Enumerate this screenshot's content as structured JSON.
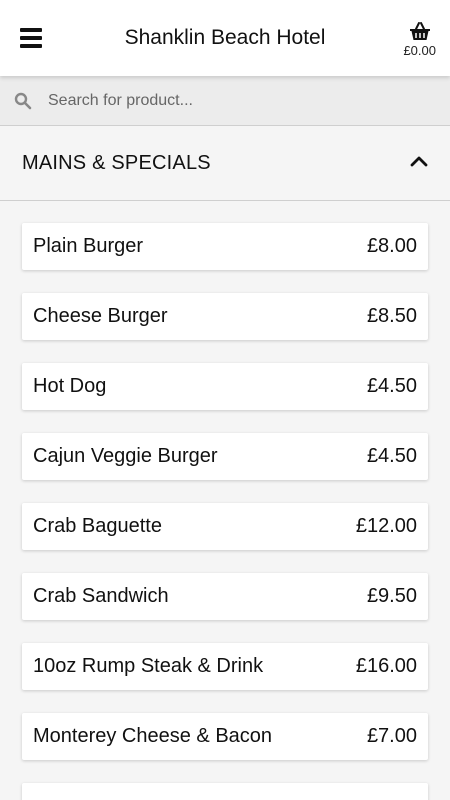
{
  "header": {
    "title": "Shanklin Beach Hotel",
    "cart_total": "£0.00"
  },
  "search": {
    "placeholder": "Search for product..."
  },
  "section": {
    "title": "MAINS & SPECIALS"
  },
  "items": [
    {
      "name": "Plain Burger",
      "price": "£8.00"
    },
    {
      "name": "Cheese Burger",
      "price": "£8.50"
    },
    {
      "name": "Hot Dog",
      "price": "£4.50"
    },
    {
      "name": "Cajun Veggie Burger",
      "price": "£4.50"
    },
    {
      "name": "Crab Baguette",
      "price": "£12.00"
    },
    {
      "name": "Crab Sandwich",
      "price": "£9.50"
    },
    {
      "name": "10oz Rump Steak & Drink",
      "price": "£16.00"
    },
    {
      "name": "Monterey Cheese & Bacon",
      "price": "£7.00"
    },
    {
      "name": "",
      "price": ""
    }
  ],
  "icons": {
    "menu": "hamburger-menu-icon",
    "cart": "basket-icon",
    "search": "search-icon",
    "collapse": "chevron-up-icon"
  }
}
